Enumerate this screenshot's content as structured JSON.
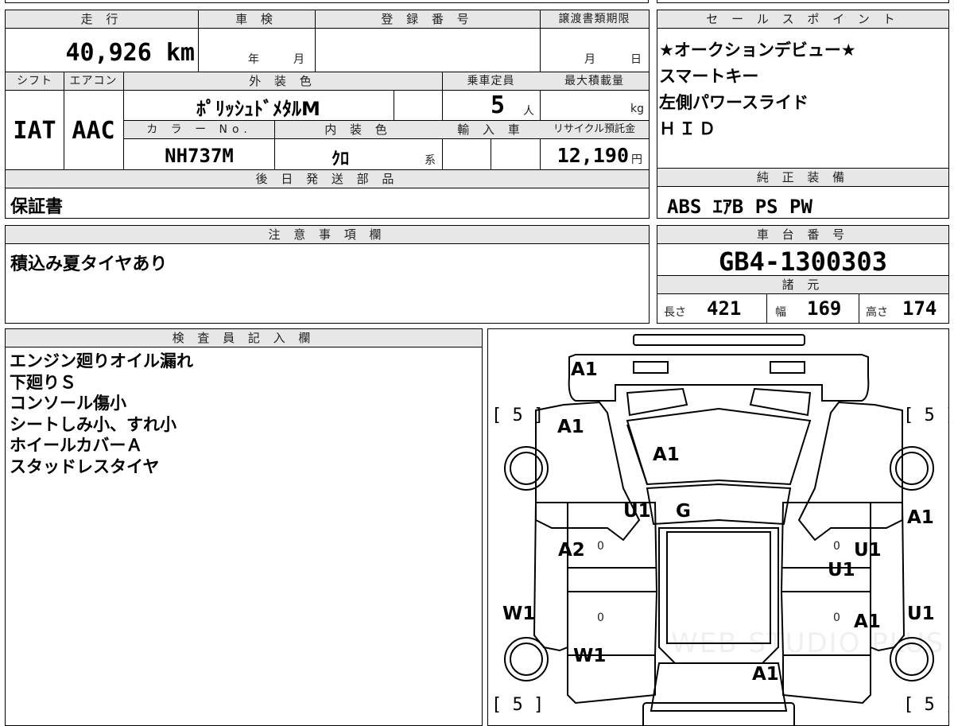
{
  "vehicle": {
    "mileage_header": "走 行",
    "mileage": "40,926 km",
    "shaken_header": "車 検",
    "shaken_year": "年",
    "shaken_month": "月",
    "reg_header": "登 録 番 号",
    "reg_value": "",
    "transfer_header": "譲渡書類期限",
    "transfer_month": "月",
    "transfer_day": "日",
    "shift_header": "シフト",
    "shift": "IAT",
    "ac_header": "エアコン",
    "ac": "AAC",
    "exterior_header": "外 装 色",
    "exterior": "ﾎﾟﾘｯｼｭﾄﾞﾒﾀﾙM",
    "capacity_header": "乗車定員",
    "capacity": "5",
    "capacity_unit": "人",
    "load_header": "最大積載量",
    "load_unit": "kg",
    "color_no_header": "カ ラ ー No.",
    "color_no": "NH737M",
    "interior_header": "内 装 色",
    "interior": "ｸﾛ",
    "interior_suffix": "系",
    "import_header": "輸 入 車",
    "recycle_header": "リサイクル預託金",
    "recycle": "12,190",
    "recycle_unit": "円",
    "later_header": "後 日 発 送 部 品",
    "later_items": "保証書"
  },
  "sales": {
    "header": "セ ー ル ス ポ イ ン ト",
    "points": [
      "★オークションデビュー★",
      "スマートキー",
      "左側パワースライド",
      "ＨＩＤ"
    ]
  },
  "equipment": {
    "header": "純 正 装 備",
    "value": "ABS ｴｱB PS PW"
  },
  "notes": {
    "header": "注 意 事 項 欄",
    "text": "積込み夏タイヤあり"
  },
  "chassis": {
    "header": "車 台 番 号",
    "value": "GB4-1300303",
    "spec_header": "諸 元",
    "length_label": "長さ",
    "length": "421",
    "width_label": "幅",
    "width": "169",
    "height_label": "高さ",
    "height": "174"
  },
  "inspector": {
    "header": "検 査 員 記 入 欄",
    "lines": [
      "エンジン廻りオイル漏れ",
      "下廻りＳ",
      "コンソール傷小",
      "シートしみ小、すれ小",
      "ホイールカバーＡ",
      "スタッドレスタイヤ"
    ]
  },
  "diagram": {
    "codes": {
      "front_bumper": "A1",
      "left_front_fender": "A1",
      "hood": "A1",
      "left_pillar": "U1",
      "windshield": "G",
      "right_front_fender": "A1",
      "left_front_door": "A2",
      "right_front_door_1": "U1",
      "right_front_door_2": "U1",
      "left_sill": "W1",
      "right_rear_door": "A1",
      "right_sill": "U1",
      "left_rear_quarter": "W1",
      "roof": "A1"
    },
    "tire_brackets": {
      "front_left": "[ 5 ]",
      "front_right": "[ 5 ]",
      "rear_left": "[ 5 ]",
      "rear_right": "[ 5 ]"
    },
    "door_marks": [
      "0",
      "0",
      "0",
      "0"
    ],
    "watermark": "WEB STUDIO PLUS"
  }
}
